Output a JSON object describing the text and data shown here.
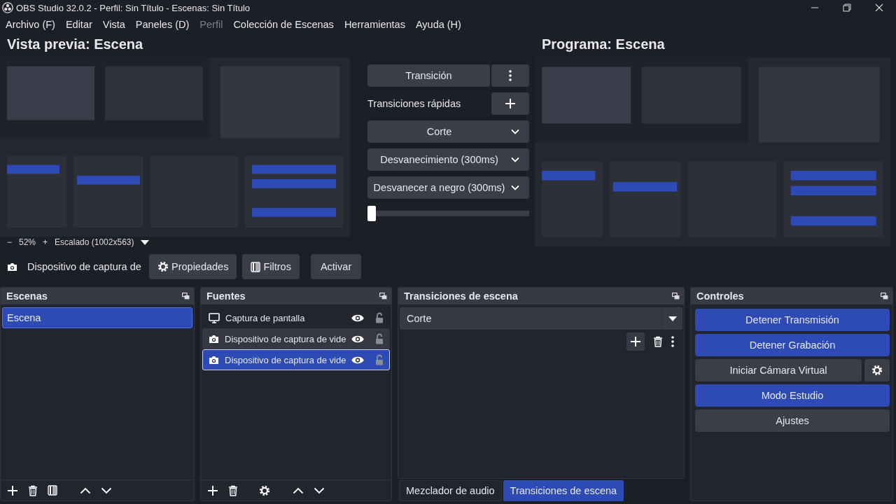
{
  "window": {
    "title": "OBS Studio 32.0.2 - Perfil: Sin Título - Escenas: Sin Título"
  },
  "menu": [
    {
      "label": "Archivo (F)",
      "disabled": false
    },
    {
      "label": "Editar",
      "disabled": false
    },
    {
      "label": "Vista",
      "disabled": false
    },
    {
      "label": "Paneles (D)",
      "disabled": false
    },
    {
      "label": "Perfil",
      "disabled": true
    },
    {
      "label": "Colección de Escenas",
      "disabled": false
    },
    {
      "label": "Herramientas",
      "disabled": false
    },
    {
      "label": "Ayuda (H)",
      "disabled": false
    }
  ],
  "preview": {
    "title": "Vista previa: Escena",
    "zoom_out": "−",
    "zoom": "52%",
    "zoom_in": "+",
    "scaling": "Escalado (1002x563)"
  },
  "program": {
    "title": "Programa: Escena"
  },
  "transition_panel": {
    "transition_button": "Transición",
    "quick_label": "Transiciones rápidas",
    "quick": [
      "Corte",
      "Desvanecimiento (300ms)",
      "Desvanecer a negro (300ms)"
    ],
    "tbar": {
      "level": 0
    }
  },
  "source_bar": {
    "source": "Dispositivo de captura de",
    "buttons": [
      {
        "kind": "properties",
        "label": "Propiedades"
      },
      {
        "kind": "filters",
        "label": "Filtros"
      },
      {
        "kind": "plain",
        "label": "Activar"
      }
    ]
  },
  "scenes": {
    "title": "Escenas",
    "items": [
      {
        "label": "Escena",
        "selected": true
      }
    ]
  },
  "sources": {
    "title": "Fuentes",
    "items": [
      {
        "kind": "display",
        "label": "Captura de pantalla",
        "visible": true,
        "locked": false,
        "selected": false,
        "hovered": false
      },
      {
        "kind": "camera",
        "label": "Dispositivo de captura de vide",
        "visible": true,
        "locked": false,
        "selected": false,
        "hovered": true
      },
      {
        "kind": "camera",
        "label": "Dispositivo de captura de vide",
        "visible": true,
        "locked": false,
        "selected": true,
        "hovered": false
      }
    ]
  },
  "transitions": {
    "title": "Transiciones de escena",
    "current": "Corte"
  },
  "controls": {
    "title": "Controles",
    "buttons": [
      {
        "label": "Detener Transmisión",
        "active": true,
        "has_settings": false
      },
      {
        "label": "Detener Grabación",
        "active": true,
        "has_settings": false
      },
      {
        "label": "Iniciar Cámara Virtual",
        "active": false,
        "has_settings": true
      },
      {
        "label": "Modo Estudio",
        "active": true,
        "has_settings": false
      },
      {
        "label": "Ajustes",
        "active": false,
        "has_settings": false
      }
    ]
  },
  "bottom_tabs": [
    {
      "label": "Mezclador de audio",
      "selected": false
    },
    {
      "label": "Transiciones de escena",
      "selected": true
    }
  ]
}
